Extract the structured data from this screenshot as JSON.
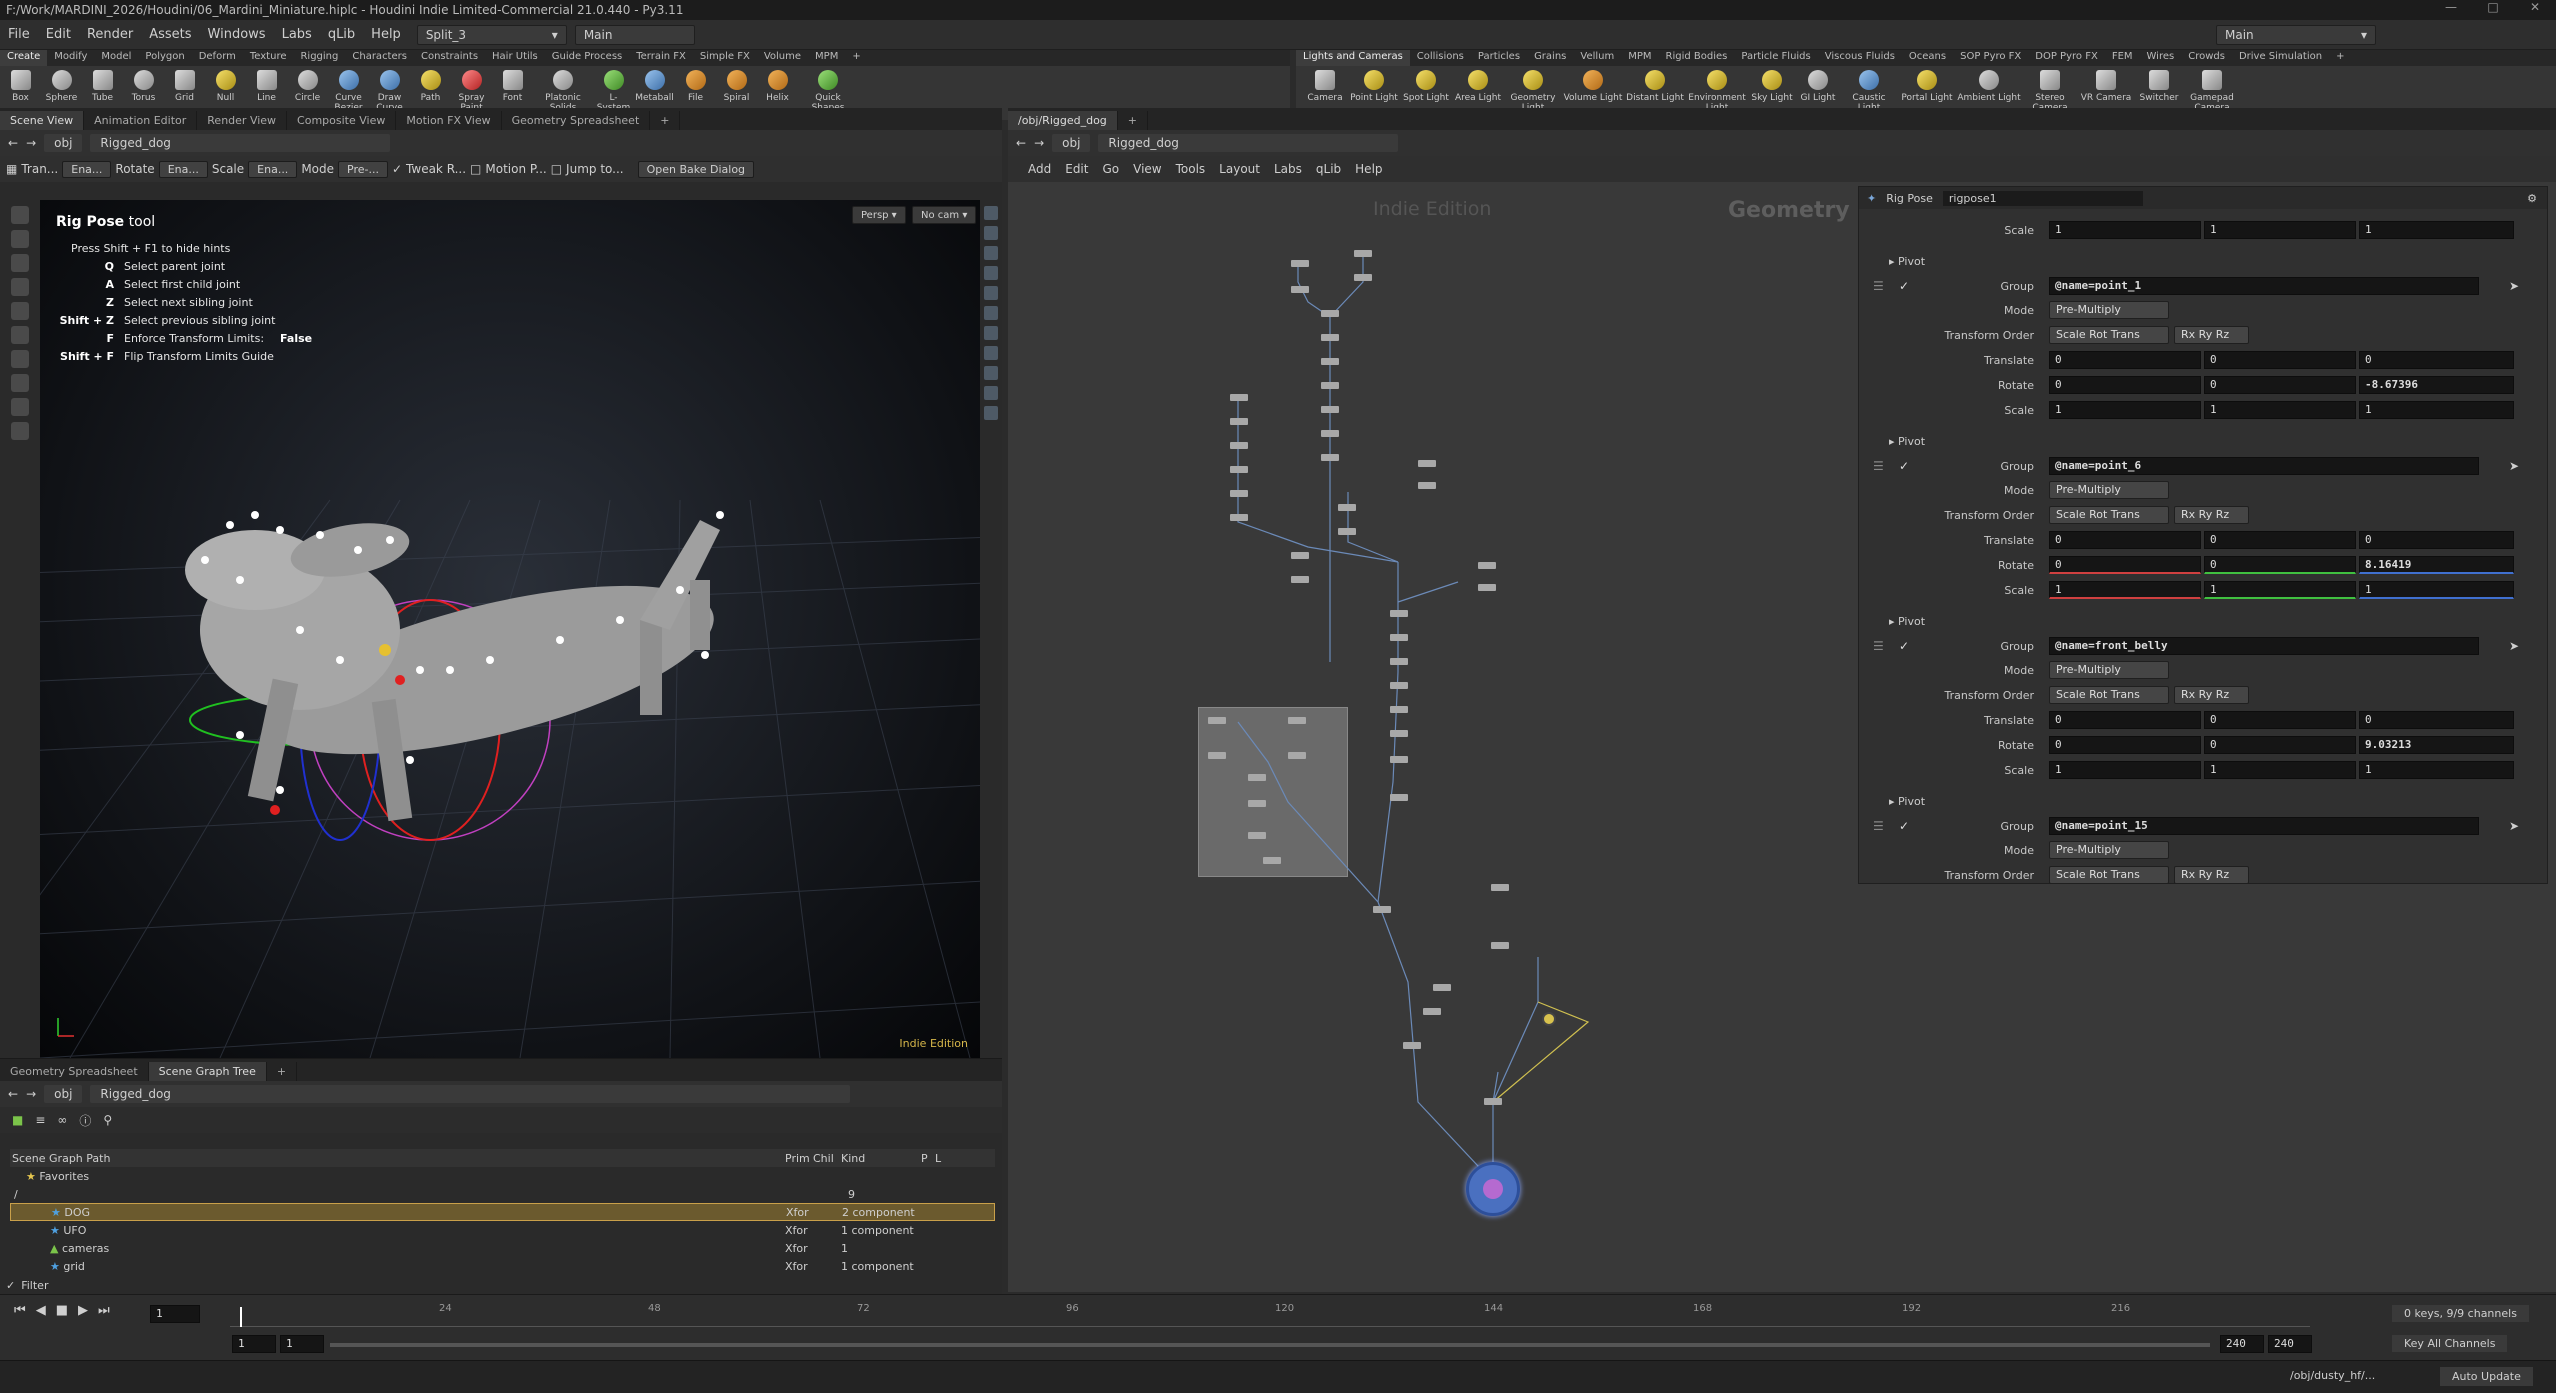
{
  "window": {
    "title": "F:/Work/MARDINI_2026/Houdini/06_Mardini_Miniature.hiplc - Houdini Indie Limited-Commercial 21.0.440 - Py3.11"
  },
  "menu": {
    "items": [
      "File",
      "Edit",
      "Render",
      "Assets",
      "Windows",
      "Labs",
      "qLib",
      "Help"
    ],
    "desktop": "Split_3",
    "network_sel": "Main",
    "right_desktop": "Main"
  },
  "shelf_left": {
    "tabs": [
      "Create",
      "Modify",
      "Model",
      "Polygon",
      "Deform",
      "Texture",
      "Rigging",
      "Characters",
      "Constraints",
      "Hair Utils",
      "Guide Process",
      "Terrain FX",
      "Simple FX",
      "Volume",
      "MPM"
    ],
    "tools": [
      "Box",
      "Sphere",
      "Tube",
      "Torus",
      "Grid",
      "Null",
      "Line",
      "Circle",
      "Curve Bezier",
      "Draw Curve",
      "Path",
      "Spray Paint",
      "Font",
      "Platonic Solids",
      "L-System",
      "Metaball",
      "File",
      "Spiral",
      "Helix",
      "Quick Shapes"
    ]
  },
  "shelf_right": {
    "tabs": [
      "Lights and Cameras",
      "Collisions",
      "Particles",
      "Grains",
      "Vellum",
      "MPM",
      "Rigid Bodies",
      "Particle Fluids",
      "Viscous Fluids",
      "Oceans",
      "SOP Pyro FX",
      "DOP Pyro FX",
      "FEM",
      "Wires",
      "Crowds",
      "Drive Simulation"
    ],
    "tools": [
      "Camera",
      "Point Light",
      "Spot Light",
      "Area Light",
      "Geometry Light",
      "Volume Light",
      "Distant Light",
      "Environment Light",
      "Sky Light",
      "GI Light",
      "Caustic Light",
      "Portal Light",
      "Ambient Light",
      "Stereo Camera",
      "VR Camera",
      "Switcher",
      "Gamepad Camera"
    ]
  },
  "left_pane": {
    "tabs": [
      "Scene View",
      "Animation Editor",
      "Render View",
      "Composite View",
      "Motion FX View",
      "Geometry Spreadsheet"
    ],
    "path": {
      "root": "obj",
      "node": "Rigged_dog"
    },
    "opbar": {
      "translate": "Tran...",
      "ena1": "Ena...",
      "rotate": "Rotate",
      "ena2": "Ena...",
      "scale": "Scale",
      "ena3": "Ena...",
      "mode": "Mode",
      "pre": "Pre-...",
      "tweak": "Tweak R...",
      "motion": "Motion P...",
      "jump": "Jump to...",
      "bake": "Open Bake Dialog"
    },
    "viewport": {
      "persp": "Persp",
      "cam": "No cam",
      "watermark": "Indie Edition",
      "tool_title_bold": "Rig Pose",
      "tool_title_rest": " tool",
      "hint_intro": "Press Shift + F1 to hide hints",
      "hints": [
        {
          "key": "Q",
          "text": "Select parent joint"
        },
        {
          "key": "A",
          "text": "Select first child joint"
        },
        {
          "key": "Z",
          "text": "Select next sibling joint"
        },
        {
          "key": "Shift + Z",
          "text": "Select previous sibling joint"
        },
        {
          "key": "F",
          "text": "Enforce Transform Limits:",
          "value": "False"
        },
        {
          "key": "Shift + F",
          "text": "Flip Transform Limits Guide"
        }
      ]
    }
  },
  "network_pane": {
    "tab": "/obj/Rigged_dog",
    "path": {
      "root": "obj",
      "node": "Rigged_dog"
    },
    "menu": [
      "Add",
      "Edit",
      "Go",
      "View",
      "Tools",
      "Layout",
      "Labs",
      "qLib",
      "Help"
    ],
    "watermark": "Indie Edition",
    "context": "Geometry"
  },
  "params": {
    "node_type": "Rig Pose",
    "node_name": "rigpose1",
    "top_scale": [
      "1",
      "1",
      "1"
    ],
    "blocks": [
      {
        "group": "@name=point_1",
        "mode": "Pre-Multiply",
        "order": "Scale Rot Trans",
        "rot_order": "Rx Ry Rz",
        "translate": [
          "0",
          "0",
          "0"
        ],
        "rotate": [
          "0",
          "0",
          "-8.67396"
        ],
        "scale": [
          "1",
          "1",
          "1"
        ]
      },
      {
        "group": "@name=point_6",
        "mode": "Pre-Multiply",
        "order": "Scale Rot Trans",
        "rot_order": "Rx Ry Rz",
        "translate": [
          "0",
          "0",
          "0"
        ],
        "rotate": [
          "0",
          "0",
          "8.16419"
        ],
        "scale": [
          "1",
          "1",
          "1"
        ]
      },
      {
        "group": "@name=front_belly",
        "mode": "Pre-Multiply",
        "order": "Scale Rot Trans",
        "rot_order": "Rx Ry Rz",
        "translate": [
          "0",
          "0",
          "0"
        ],
        "rotate": [
          "0",
          "0",
          "9.03213"
        ],
        "scale": [
          "1",
          "1",
          "1"
        ]
      },
      {
        "group": "@name=point_15",
        "mode": "Pre-Multiply",
        "order": "Scale Rot Trans",
        "rot_order": "Rx Ry Rz"
      }
    ],
    "labels": {
      "scale": "Scale",
      "pivot": "Pivot",
      "group": "Group",
      "mode": "Mode",
      "order": "Transform Order",
      "translate": "Translate",
      "rotate": "Rotate"
    }
  },
  "scene_graph": {
    "tabs": [
      "Geometry Spreadsheet",
      "Scene Graph Tree"
    ],
    "path": {
      "root": "obj",
      "node": "Rigged_dog"
    },
    "columns": [
      "Scene Graph Path",
      "Prim",
      "Chil",
      "Kind",
      "P",
      "L"
    ],
    "favorites": "Favorites",
    "root": "/",
    "root_count": "9",
    "rows": [
      {
        "name": "DOG",
        "prim": "Xfor",
        "kind": "2 component"
      },
      {
        "name": "UFO",
        "prim": "Xfor",
        "kind": "1 component"
      },
      {
        "name": "cameras",
        "prim": "Xfor",
        "kind": "1"
      },
      {
        "name": "grid",
        "prim": "Xfor",
        "kind": "1 component"
      }
    ],
    "filter": "Filter"
  },
  "timeline": {
    "frame": "1",
    "ticks": [
      "24",
      "48",
      "72",
      "96",
      "120",
      "144",
      "168",
      "192",
      "216"
    ],
    "start": "1",
    "start2": "1",
    "end": "240",
    "end2": "240",
    "keys": "0 keys, 9/9 channels",
    "keyall": "Key All Channels"
  },
  "status": {
    "path": "/obj/dusty_hf/...",
    "update": "Auto Update"
  }
}
